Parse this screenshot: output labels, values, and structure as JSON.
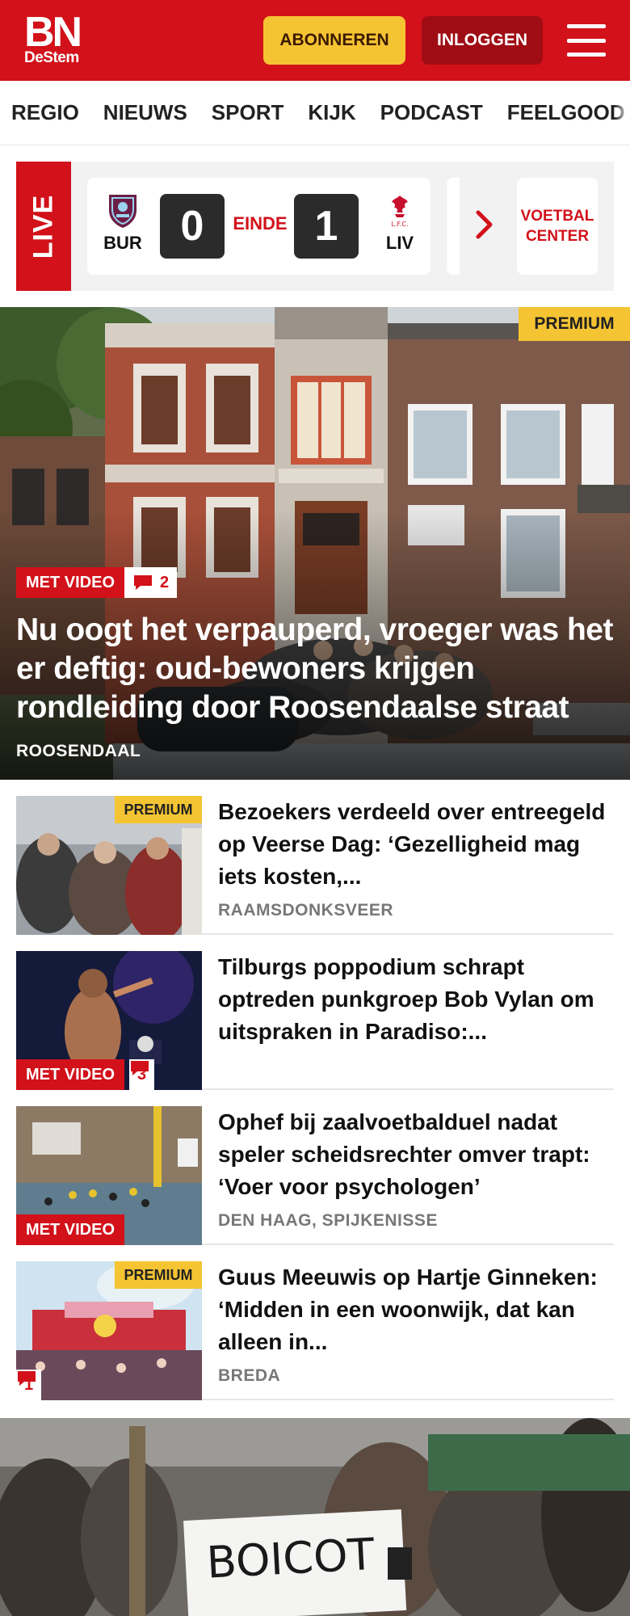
{
  "header": {
    "logo_main": "BN",
    "logo_sub": "DeStem",
    "subscribe_label": "ABONNEREN",
    "login_label": "INLOGGEN",
    "brand_color": "#d2111a",
    "subscribe_color": "#f5c432"
  },
  "nav": {
    "items": [
      "REGIO",
      "NIEUWS",
      "SPORT",
      "KIJK",
      "PODCAST",
      "FEELGOOD"
    ]
  },
  "live": {
    "label": "LIVE",
    "home_team": "BUR",
    "away_team": "LIV",
    "home_score": "0",
    "away_score": "1",
    "status": "EINDE",
    "away_crest_text": "L.F.C.",
    "center_label_line1": "VOETBAL",
    "center_label_line2": "CENTER"
  },
  "hero": {
    "premium_label": "PREMIUM",
    "video_label": "MET VIDEO",
    "comment_count": "2",
    "title": "Nu oogt het verpauperd, vroeger was het er deftig: oud-bewoners krijgen rondleiding door Roosendaalse straat",
    "location": "ROOSENDAAL"
  },
  "articles": [
    {
      "title": "Bezoekers verdeeld over entreegeld op Veerse Dag: ‘Gezelligheid mag iets kosten,...",
      "location": "RAAMSDONKSVEER",
      "premium_label": "PREMIUM"
    },
    {
      "title": "Tilburgs poppodium schrapt optreden punkgroep Bob Vylan om uitspraken in Paradiso:...",
      "video_label": "MET VIDEO",
      "comment_count": "3"
    },
    {
      "title": "Ophef bij zaalvoetbalduel nadat speler scheidsrechter omver trapt: ‘Voer voor psychologen’",
      "location": "DEN HAAG, SPIJKENISSE",
      "video_label": "MET VIDEO"
    },
    {
      "title": "Guus Meeuwis op Hartje Ginneken: ‘Midden in een woonwijk, dat kan alleen in...",
      "location": "BREDA",
      "premium_label": "PREMIUM",
      "comment_count": "1"
    }
  ],
  "bottom_photo": {
    "sign_text": "BOICOT"
  }
}
